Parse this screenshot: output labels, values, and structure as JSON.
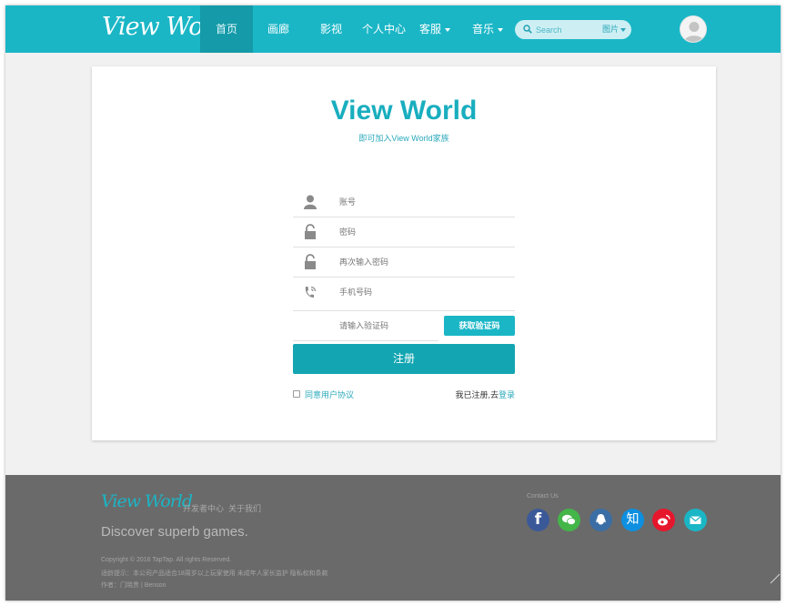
{
  "navbar": {
    "logo": "View World",
    "items": [
      {
        "label": "首页",
        "active": true
      },
      {
        "label": "画廊"
      },
      {
        "label": "影视"
      },
      {
        "label": "个人中心"
      },
      {
        "label": "客服",
        "dropdown": true
      },
      {
        "label": "音乐",
        "dropdown": true
      }
    ],
    "search": {
      "placeholder": "Search",
      "type_label": "图片"
    },
    "accent_color": "#1ab6c6"
  },
  "register": {
    "title": "View World",
    "subtitle": "即可加入View World家族",
    "fields": [
      {
        "placeholder": "账号",
        "icon": "user-icon"
      },
      {
        "placeholder": "密码",
        "icon": "lock-icon"
      },
      {
        "placeholder": "再次输入密码",
        "icon": "lock-icon"
      },
      {
        "placeholder": "手机号码",
        "icon": "phone-icon"
      }
    ],
    "code_placeholder": "请输入验证码",
    "get_code_label": "获取验证码",
    "submit_label": "注册",
    "agree_label": "同意用户协议",
    "login_prompt": "我已注册,去",
    "login_link": "登录"
  },
  "footer": {
    "logo": "View World",
    "links": [
      "开发者中心",
      "关于我们"
    ],
    "slogan": "Discover superb games.",
    "copyright": "Copyright © 2016 TapTap. All rights Reserved.",
    "notice": "适龄提示：本公司产品适合18周岁以上玩家使用   未成年人家长监护  隐私权和条款",
    "author": "作者：门晓贵 | Benson",
    "contact_label": "Contact Us",
    "social": [
      {
        "name": "facebook-icon",
        "glyph": "f",
        "color": "#3b5998"
      },
      {
        "name": "wechat-icon",
        "glyph": "",
        "color": "#44b549"
      },
      {
        "name": "qq-icon",
        "glyph": "",
        "color": "#3a6ea5"
      },
      {
        "name": "zhihu-icon",
        "glyph": "知",
        "color": "#0e8fe0"
      },
      {
        "name": "weibo-icon",
        "glyph": "",
        "color": "#e6162d"
      },
      {
        "name": "mail-icon",
        "glyph": "",
        "color": "#1ab6c6"
      }
    ]
  }
}
